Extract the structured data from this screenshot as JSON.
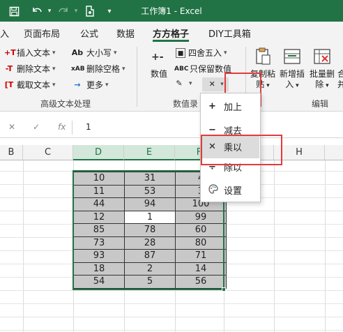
{
  "titlebar": {
    "title": "工作簿1  -  Excel",
    "qa_icons": [
      "save-icon",
      "undo-icon",
      "redo-icon",
      "touch-mode-icon",
      "customize-icon"
    ],
    "bg_color": "#217346"
  },
  "tabs": [
    {
      "label": "入"
    },
    {
      "label": "页面布局"
    },
    {
      "label": "公式"
    },
    {
      "label": "数据"
    },
    {
      "label": "方方格子"
    },
    {
      "label": "DIY工具箱"
    }
  ],
  "active_tab": "方方格子",
  "ribbon": {
    "text_group": {
      "insert_text": "插入文本",
      "delete_text": "删除文本",
      "extract_text": "截取文本",
      "case": "大小写",
      "delete_spaces": "删除空格",
      "more": "更多",
      "label": "高级文本处理"
    },
    "number_group": {
      "values": "数值",
      "round": "四舍五入",
      "keep_values": "只保留数值",
      "label": "数值录"
    },
    "edit_group": {
      "copy_paste": "复制粘贴",
      "copy_paste_line1": "复制粘",
      "copy_paste_line2": "贴",
      "add_insert_line1": "新增插",
      "add_insert_line2": "入",
      "batch_delete_line1": "批量删",
      "batch_delete_line2": "除",
      "partial_line1": "合",
      "partial_line2": "并",
      "label": "编辑"
    }
  },
  "formula_bar": {
    "cancel_icon": "✕",
    "confirm_icon": "✓",
    "fx_label": "fx",
    "value": "1"
  },
  "columns": [
    "B",
    "C",
    "D",
    "E",
    "F",
    "G",
    "H"
  ],
  "selected_columns": [
    "D",
    "E",
    "F"
  ],
  "table": {
    "rows": [
      [
        "10",
        "31",
        "4"
      ],
      [
        "11",
        "53",
        "3"
      ],
      [
        "44",
        "94",
        "100"
      ],
      [
        "12",
        "1",
        "99"
      ],
      [
        "85",
        "78",
        "60"
      ],
      [
        "73",
        "28",
        "80"
      ],
      [
        "93",
        "87",
        "71"
      ],
      [
        "18",
        "2",
        "14"
      ],
      [
        "54",
        "5",
        "56"
      ]
    ],
    "active_cell": {
      "row": 3,
      "col": 1
    }
  },
  "dropdown_menu": {
    "items": [
      {
        "icon": "+",
        "label": "加上"
      },
      {
        "icon": "−",
        "label": "减去"
      },
      {
        "icon": "✕",
        "label": "乘以"
      },
      {
        "icon": "÷",
        "label": "除以"
      },
      {
        "icon": "palette",
        "label": "设置"
      }
    ],
    "hovered": "乘以"
  },
  "colors": {
    "excel_green": "#217346",
    "highlight_red": "#e23b3b",
    "data_fill": "#c8c8c8",
    "menu_hover": "#dcdcdc"
  }
}
